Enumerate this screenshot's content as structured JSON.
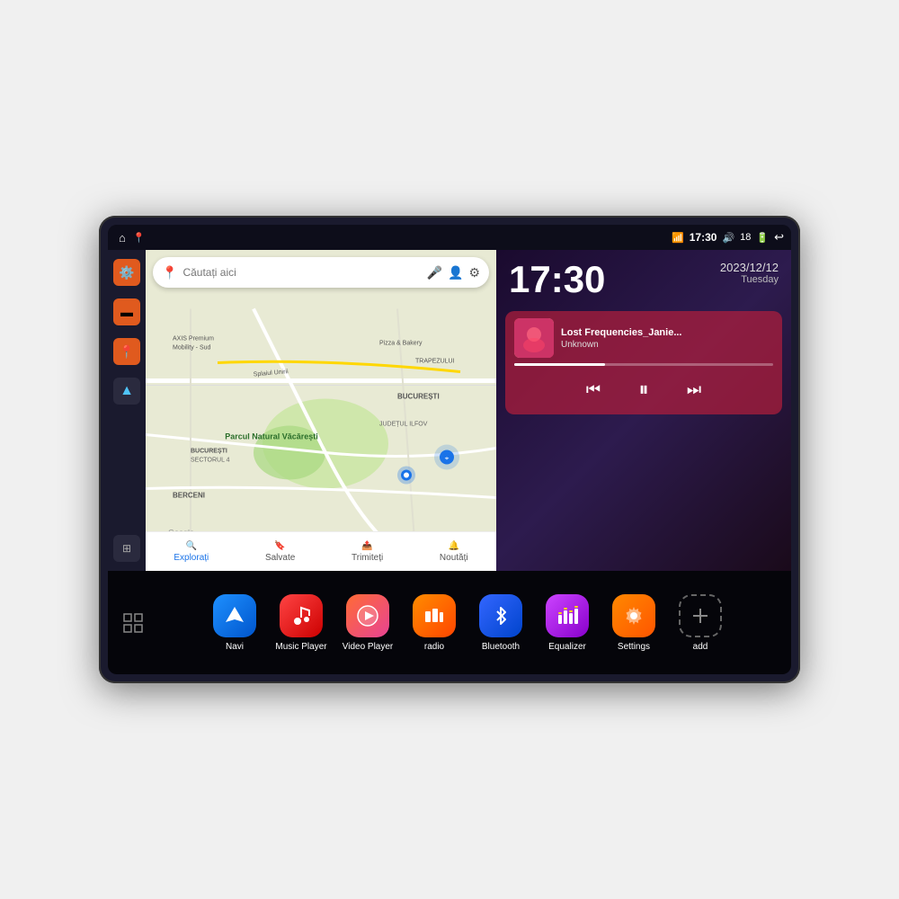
{
  "device": {
    "status_bar": {
      "time": "17:30",
      "battery": "18",
      "wifi_icon": "📶",
      "sound_icon": "🔊"
    },
    "sidebar": {
      "icons": [
        "⚙️",
        "📁",
        "📍",
        "▲"
      ]
    },
    "map": {
      "search_placeholder": "Căutați aici",
      "locations": [
        "AXIS Premium Mobility - Sud",
        "Pizza & Bakery",
        "Parcul Natural Văcărești",
        "BUCUREȘTI",
        "BUCUREȘTI SECTORUL 4",
        "BERCENI",
        "JUDEȚUL ILFOV",
        "TRAPEZULUI"
      ],
      "nav_items": [
        {
          "label": "Explorați",
          "active": true
        },
        {
          "label": "Salvate",
          "active": false
        },
        {
          "label": "Trimiteți",
          "active": false
        },
        {
          "label": "Noutăți",
          "active": false
        }
      ]
    },
    "clock": {
      "time": "17:30",
      "date": "2023/12/12",
      "day": "Tuesday"
    },
    "music": {
      "title": "Lost Frequencies_Janie...",
      "artist": "Unknown",
      "progress": 35
    },
    "apps": [
      {
        "id": "navi",
        "label": "Navi",
        "icon_class": "app-navi",
        "icon": "▲"
      },
      {
        "id": "music-player",
        "label": "Music Player",
        "icon_class": "app-music",
        "icon": "🎵"
      },
      {
        "id": "video-player",
        "label": "Video Player",
        "icon_class": "app-video",
        "icon": "▶"
      },
      {
        "id": "radio",
        "label": "radio",
        "icon_class": "app-radio",
        "icon": "📻"
      },
      {
        "id": "bluetooth",
        "label": "Bluetooth",
        "icon_class": "app-bluetooth",
        "icon": "⬡"
      },
      {
        "id": "equalizer",
        "label": "Equalizer",
        "icon_class": "app-equalizer",
        "icon": "🎚"
      },
      {
        "id": "settings",
        "label": "Settings",
        "icon_class": "app-settings",
        "icon": "⚙️"
      },
      {
        "id": "add",
        "label": "add",
        "icon_class": "app-add",
        "icon": "＋"
      }
    ]
  }
}
